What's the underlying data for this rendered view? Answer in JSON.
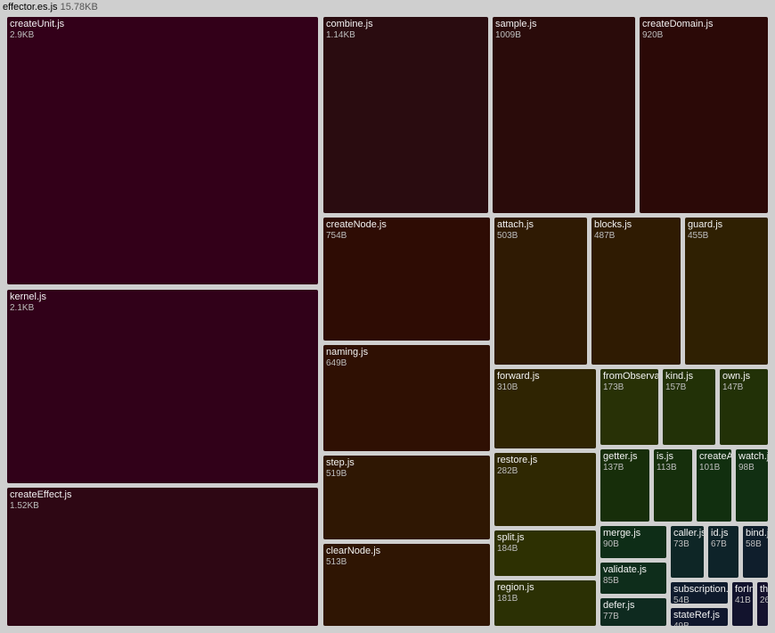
{
  "header": {
    "title": "effector.es.js",
    "size": "15.78KB"
  },
  "chart_data": {
    "type": "treemap",
    "title": "effector.es.js",
    "total": "15.78KB",
    "items": [
      {
        "name": "createUnit.js",
        "size": "2.9KB",
        "color": "#330019"
      },
      {
        "name": "kernel.js",
        "size": "2.1KB",
        "color": "#310119"
      },
      {
        "name": "createEffect.js",
        "size": "1.52KB",
        "color": "#2e0714"
      },
      {
        "name": "combine.js",
        "size": "1.14KB",
        "color": "#2a0c10"
      },
      {
        "name": "sample.js",
        "size": "1009B",
        "color": "#2a0b0a"
      },
      {
        "name": "createDomain.js",
        "size": "920B",
        "color": "#2b0907"
      },
      {
        "name": "createNode.js",
        "size": "754B",
        "color": "#2e0c04"
      },
      {
        "name": "naming.js",
        "size": "649B",
        "color": "#2f1003"
      },
      {
        "name": "step.js",
        "size": "519B",
        "color": "#2f1703"
      },
      {
        "name": "clearNode.js",
        "size": "513B",
        "color": "#2f1503"
      },
      {
        "name": "attach.js",
        "size": "503B",
        "color": "#2f1a03"
      },
      {
        "name": "blocks.js",
        "size": "487B",
        "color": "#2f1b02"
      },
      {
        "name": "guard.js",
        "size": "455B",
        "color": "#2f2002"
      },
      {
        "name": "forward.js",
        "size": "310B",
        "color": "#2f2402"
      },
      {
        "name": "restore.js",
        "size": "282B",
        "color": "#2f2802"
      },
      {
        "name": "split.js",
        "size": "184B",
        "color": "#2d3002"
      },
      {
        "name": "region.js",
        "size": "181B",
        "color": "#2b3004"
      },
      {
        "name": "fromObservable.js",
        "label": "fromObserva",
        "size": "173B",
        "color": "#283106"
      },
      {
        "name": "kind.js",
        "size": "157B",
        "color": "#223107"
      },
      {
        "name": "own.js",
        "size": "147B",
        "color": "#223107"
      },
      {
        "name": "getter.js",
        "size": "137B",
        "color": "#172e0a"
      },
      {
        "name": "is.js",
        "size": "113B",
        "color": "#162f0c"
      },
      {
        "name": "createApi.js",
        "label": "createA",
        "size": "101B",
        "color": "#112f0f"
      },
      {
        "name": "watch.js",
        "label": "watch.js",
        "size": "98B",
        "color": "#112f12"
      },
      {
        "name": "merge.js",
        "size": "90B",
        "color": "#0e2d17"
      },
      {
        "name": "validate.js",
        "size": "85B",
        "color": "#0e2d1b"
      },
      {
        "name": "defer.js",
        "size": "77B",
        "color": "#0e2a1f"
      },
      {
        "name": "caller.js",
        "label": "caller.js",
        "size": "73B",
        "color": "#0e2626"
      },
      {
        "name": "id.js",
        "size": "67B",
        "color": "#0e2329"
      },
      {
        "name": "bind.js",
        "label": "bind.js",
        "size": "58B",
        "color": "#0f1e2c"
      },
      {
        "name": "subscription.js",
        "label": "subscription.j",
        "size": "54B",
        "color": "#0f1b2d"
      },
      {
        "name": "stateRef.js",
        "size": "49B",
        "color": "#10172d"
      },
      {
        "name": "forIn.js",
        "label": "forIn",
        "size": "41B",
        "color": "#12132d"
      },
      {
        "name": "throw.js",
        "label": "th",
        "size": "26B",
        "color": "#15122e"
      }
    ]
  }
}
